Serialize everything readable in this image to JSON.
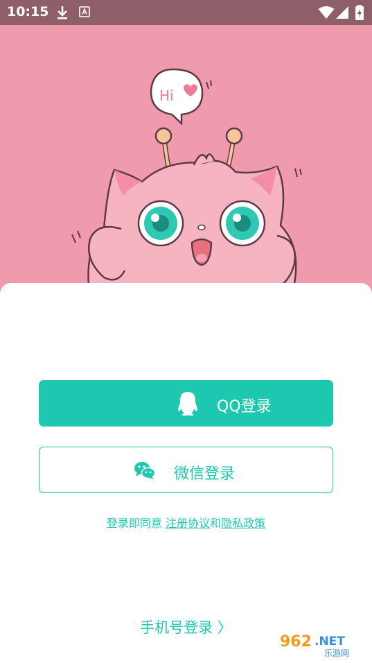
{
  "status_bar": {
    "time": "10:15"
  },
  "hero": {
    "speech_bubble_text": "Hi"
  },
  "login": {
    "qq_label": "QQ登录",
    "wechat_label": "微信登录",
    "agreement_prefix": "登录即同意",
    "terms_link": "注册协议",
    "and_text": "和",
    "privacy_link": "隐私政策",
    "phone_login_label": "手机号登录 〉"
  },
  "watermark": {
    "brand": "962.NET",
    "subtitle": "乐游网"
  },
  "colors": {
    "accent": "#1ec8b0",
    "hero_bg": "#f09aad",
    "status_bg": "#8e5f69"
  }
}
